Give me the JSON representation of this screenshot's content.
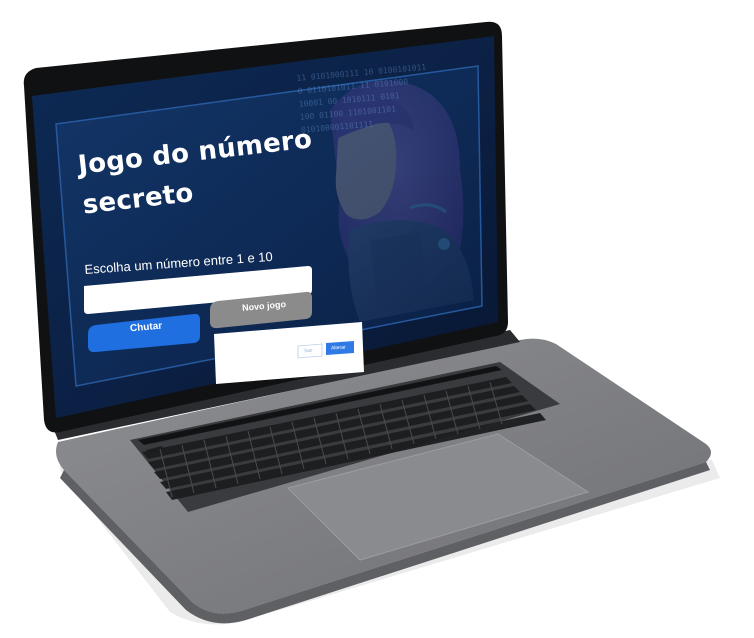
{
  "game": {
    "title": "Jogo do número secreto",
    "instruction": "Escolha um número entre 1 e 10",
    "input_value": "",
    "guess_button": "Chutar",
    "new_game_button": "Novo jogo"
  },
  "dialog": {
    "cancel_label": "Sair",
    "ok_label": "Alterar"
  },
  "colors": {
    "screen_bg": "#0a1d3a",
    "card_border": "#2a5fa8",
    "primary_button": "#1f6fe0",
    "disabled_button": "#8b8b8b",
    "laptop_body": "#7d7e82"
  }
}
